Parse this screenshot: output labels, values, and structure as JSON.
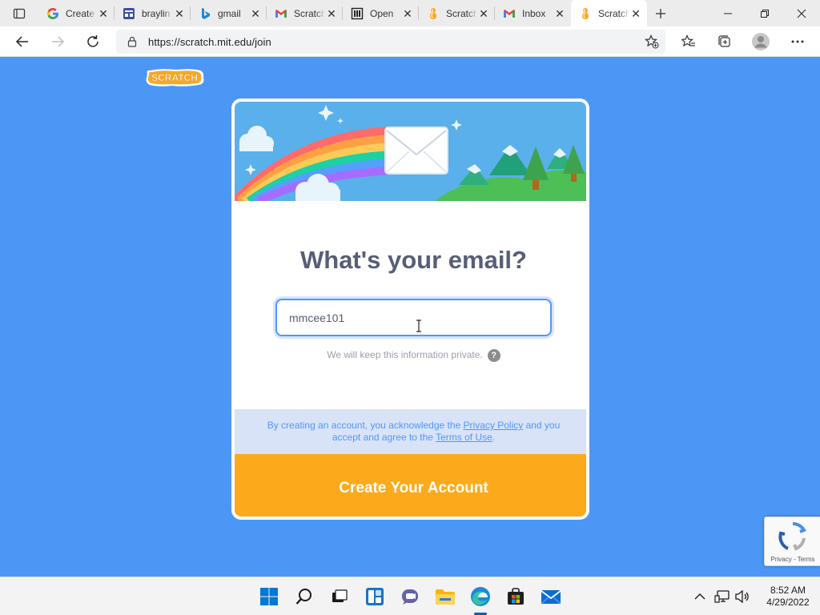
{
  "browser": {
    "tabs": [
      {
        "title": "Create",
        "icon": "google-icon"
      },
      {
        "title": "braylin",
        "icon": "form-icon"
      },
      {
        "title": "gmail",
        "icon": "bing-icon"
      },
      {
        "title": "Scratch",
        "icon": "gmail-icon"
      },
      {
        "title": "Open",
        "icon": "news-icon"
      },
      {
        "title": "Scratch",
        "icon": "scratch-icon"
      },
      {
        "title": "Inbox",
        "icon": "gmail-icon"
      },
      {
        "title": "Scratch",
        "icon": "scratch-icon",
        "active": true
      }
    ],
    "url": "https://scratch.mit.edu/join"
  },
  "page": {
    "logo_text": "SCRATCH",
    "heading": "What's your email?",
    "email_value": "mmcee101",
    "private_note": "We will keep this information private.",
    "help_glyph": "?",
    "legal": {
      "part1": "By creating an account, you acknowledge the ",
      "privacy_link": "Privacy Policy",
      "part2": " and you accept and agree to the ",
      "terms_link": "Terms of Use",
      "part3": "."
    },
    "create_button": "Create Your Account",
    "recaptcha_text": "Privacy - Terms"
  },
  "taskbar": {
    "time": "8:52 AM",
    "date": "4/29/2022",
    "apps": [
      "start-icon",
      "search-icon",
      "task-view-icon",
      "widgets-icon",
      "teams-chat-icon",
      "file-explorer-icon",
      "edge-icon",
      "store-icon",
      "mail-icon"
    ]
  },
  "colors": {
    "page_bg": "#4c97f5",
    "accent_blue": "#4c97ff",
    "button_orange": "#fcaa1b",
    "heading_text": "#575e75"
  }
}
